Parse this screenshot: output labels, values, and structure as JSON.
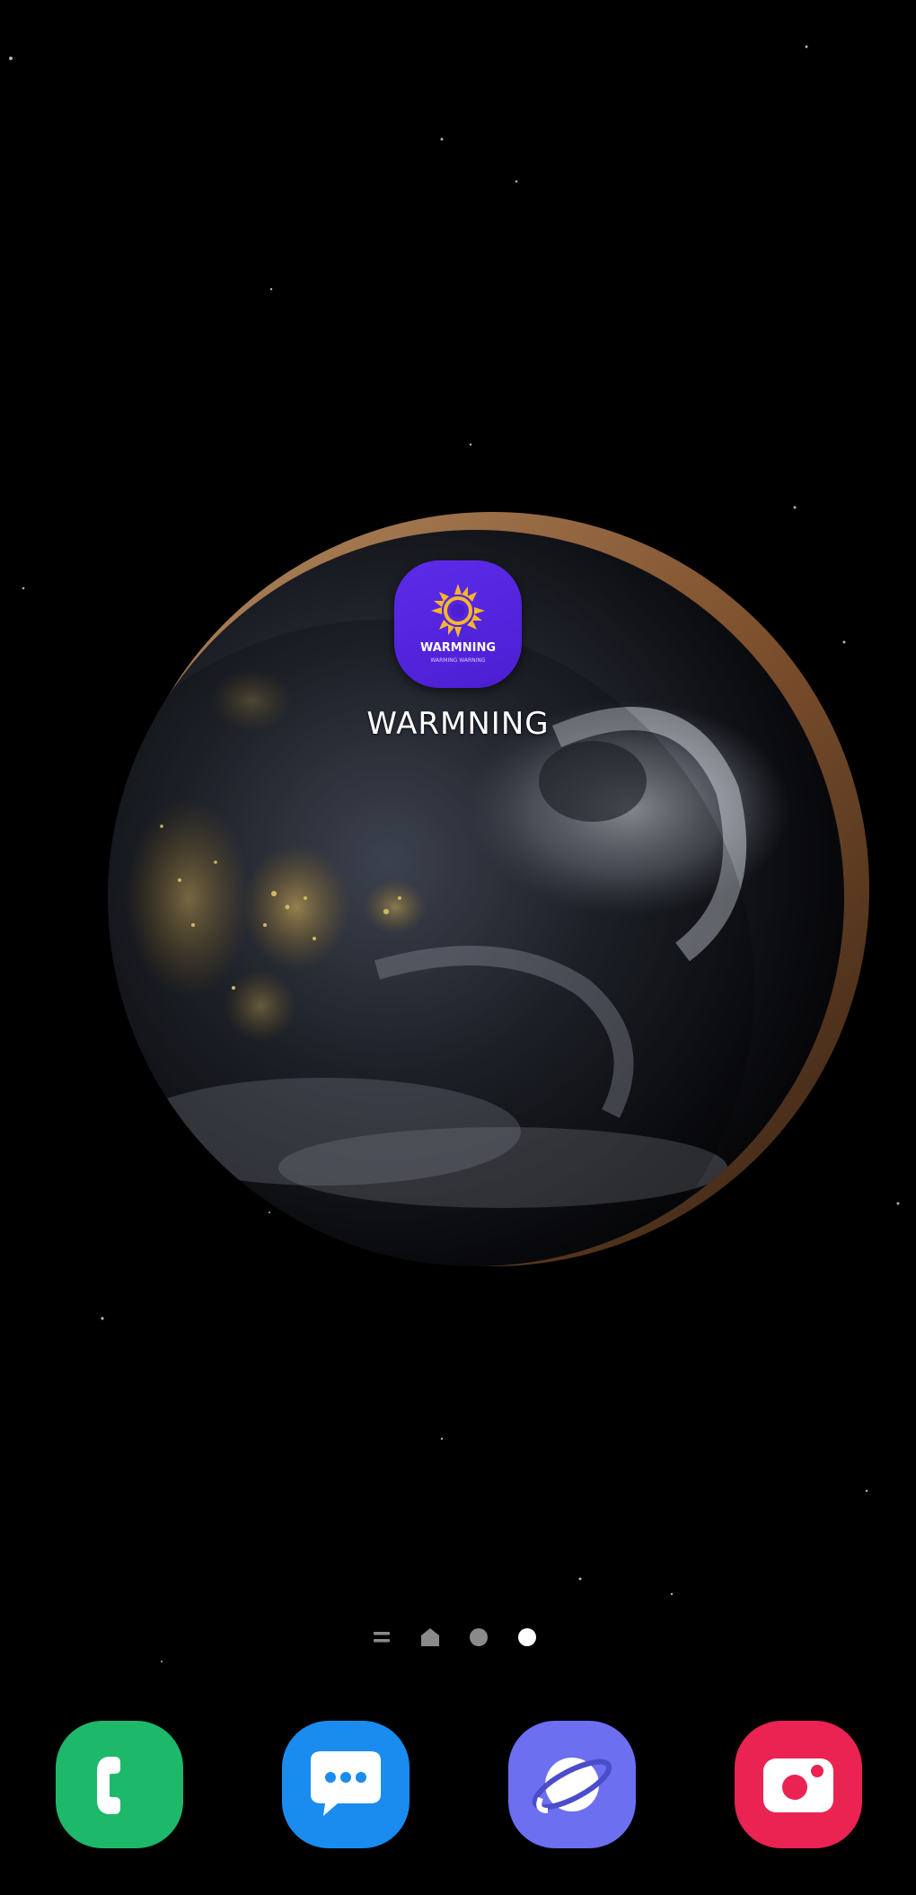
{
  "home_screen": {
    "wallpaper": "night-earth-from-space",
    "shortcut": {
      "label": "WARMNING",
      "icon_text": "WARMNING",
      "icon_subtext": "WARMING WARNING",
      "icon": "sun-logo-icon",
      "icon_color": "#5322e0",
      "sun_color": "#f5b72a"
    },
    "page_indicator": {
      "pages": [
        "apps-list",
        "home",
        "page-2",
        "page-3"
      ],
      "active_index": 3,
      "active_color": "#ffffff",
      "inactive_color": "#8a8a8a"
    },
    "dock": [
      {
        "name": "phone",
        "icon": "phone-icon",
        "color": "#1db86a"
      },
      {
        "name": "messages",
        "icon": "message-bubble-icon",
        "color": "#1a8cf0"
      },
      {
        "name": "internet",
        "icon": "planet-icon",
        "color": "#6c6ff0"
      },
      {
        "name": "camera",
        "icon": "camera-icon",
        "color": "#ea2352"
      }
    ]
  }
}
